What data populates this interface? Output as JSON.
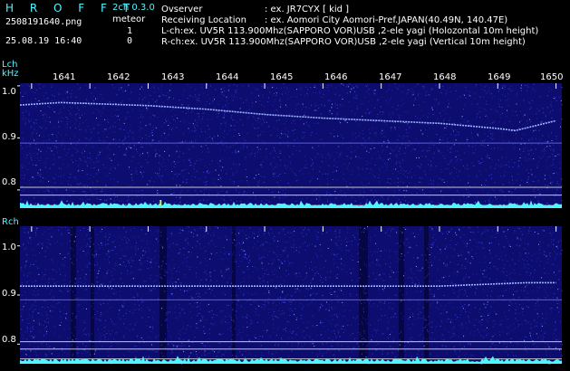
{
  "header": {
    "app_title": "H R O F F T",
    "version": "2ch 0.3.0",
    "mode": "meteor",
    "filename": "2508191640.png",
    "datetime": "25.08.19 16:40",
    "lch_count": "1",
    "rch_count": "0",
    "observer_label": "Ovserver",
    "observer_value": ": ex. JR7CYX [ kid ]",
    "location_label": "Receiving Location",
    "location_value": ": ex. Aomori City Aomori-Pref.JAPAN(40.49N, 140.47E)",
    "lch_info": "L-ch:ex. UV5R 113.900Mhz(SAPPORO VOR)USB ,2-ele yagi (Holozontal 10m height)",
    "rch_info": "R-ch:ex. UV5R 113.900Mhz(SAPPORO VOR)USB ,2-ele yagi (Vertical 10m height)"
  },
  "colors": {
    "cyan": "#4ff5ff",
    "spectrogram_blue": "#0d0d70",
    "grid_white": "#c8c8c8"
  },
  "lch_panel": {
    "label": "Lch",
    "unit": "kHz",
    "y_ticks": [
      "1.0",
      "0.9",
      "0.8"
    ]
  },
  "rch_panel": {
    "label": "Rch",
    "y_ticks": [
      "1.0",
      "0.9",
      "0.8"
    ]
  },
  "time_axis": {
    "ticks": [
      "1641",
      "1642",
      "1643",
      "1644",
      "1645",
      "1646",
      "1647",
      "1648",
      "1649",
      "1650"
    ]
  },
  "chart_data": {
    "type": "heatmap",
    "x_ticks": [
      "1641",
      "1642",
      "1643",
      "1644",
      "1645",
      "1646",
      "1647",
      "1648",
      "1649",
      "1650"
    ],
    "y_ticks": [
      "1.0",
      "0.9",
      "0.8"
    ],
    "ylabel": "kHz",
    "series": [
      {
        "name": "Lch",
        "x": [
          1640.8,
          1641.5,
          1643.0,
          1644.0,
          1645.0,
          1646.0,
          1647.0,
          1648.0,
          1649.0,
          1649.3,
          1650.0
        ],
        "y": [
          0.963,
          0.968,
          0.962,
          0.955,
          0.945,
          0.938,
          0.933,
          0.928,
          0.918,
          0.914,
          0.933
        ]
      },
      {
        "name": "Rch",
        "x": [
          1640.8,
          1645.0,
          1648.0,
          1649.5,
          1650.0
        ],
        "y": [
          0.918,
          0.918,
          0.918,
          0.925,
          0.925
        ]
      }
    ]
  }
}
